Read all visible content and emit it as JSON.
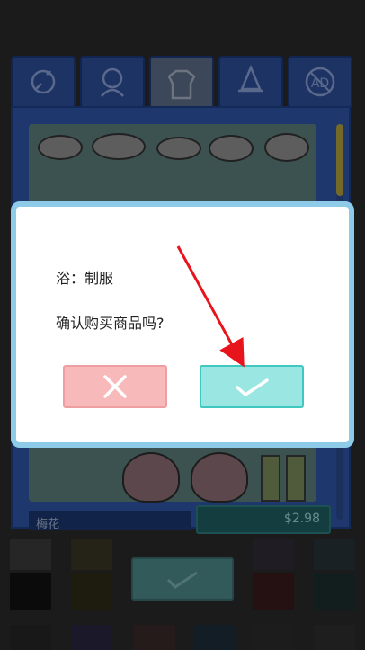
{
  "background": {
    "tabs": [
      {
        "icon": "fairy-icon"
      },
      {
        "icon": "hair-icon"
      },
      {
        "icon": "jacket-icon",
        "active": true
      },
      {
        "icon": "witch-hat-icon"
      },
      {
        "icon": "ad-icon",
        "label": "AD"
      }
    ],
    "item_name": "梅花",
    "item_price": "$2.98",
    "palette_colors": [
      "#1a1a1a",
      "#3c3821",
      "#3c2130",
      "#21283c",
      "#213c36",
      "#3c2121",
      "#25233c",
      "#21343c"
    ]
  },
  "dialog": {
    "item_line": "浴：制服",
    "question": "确认购买商品吗?",
    "cancel_icon": "close-icon",
    "confirm_icon": "checkmark-icon"
  },
  "colors": {
    "dialog_border": "#8ecbe9",
    "cancel_bg": "#f7b9ba",
    "confirm_bg": "#99e6e3",
    "arrow": "#e8141b"
  }
}
